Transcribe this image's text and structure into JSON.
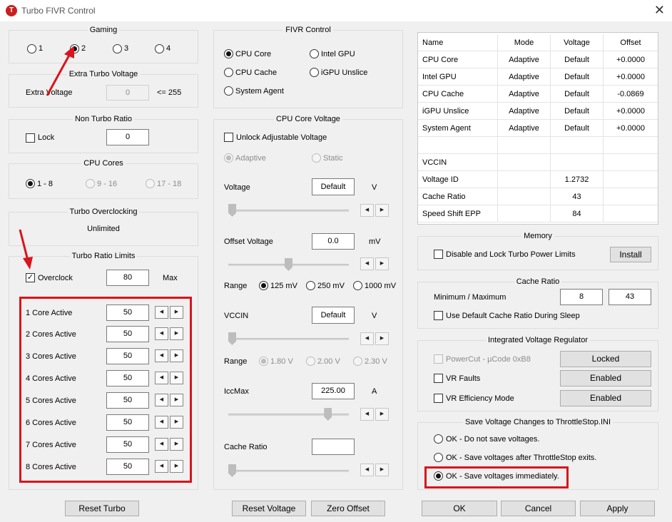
{
  "window": {
    "title": "Turbo FIVR Control",
    "icon_letter": "T",
    "close": "✕"
  },
  "gaming": {
    "title": "Gaming",
    "options": [
      "1",
      "2",
      "3",
      "4"
    ],
    "selected": "2"
  },
  "extra_turbo": {
    "title": "Extra Turbo Voltage",
    "label": "Extra Voltage",
    "value": "0",
    "suffix": "<= 255"
  },
  "non_turbo": {
    "title": "Non Turbo Ratio",
    "lock_label": "Lock",
    "value": "0"
  },
  "cpu_cores": {
    "title": "CPU Cores",
    "options": [
      "1 - 8",
      "9 - 16",
      "17 - 18"
    ]
  },
  "turbo_oc": {
    "title": "Turbo Overclocking",
    "value": "Unlimited"
  },
  "turbo_ratio": {
    "title": "Turbo Ratio Limits",
    "overclock_label": "Overclock",
    "overclock_checked": true,
    "overclock_value": "80",
    "max_label": "Max",
    "rows": [
      {
        "label": "1 Core Active",
        "value": "50"
      },
      {
        "label": "2 Cores Active",
        "value": "50"
      },
      {
        "label": "3 Cores Active",
        "value": "50"
      },
      {
        "label": "4 Cores Active",
        "value": "50"
      },
      {
        "label": "5 Cores Active",
        "value": "50"
      },
      {
        "label": "6 Cores Active",
        "value": "50"
      },
      {
        "label": "7 Cores Active",
        "value": "50"
      },
      {
        "label": "8 Cores Active",
        "value": "50"
      }
    ],
    "reset_button": "Reset Turbo"
  },
  "fivr_control": {
    "title": "FIVR Control",
    "options": [
      "CPU Core",
      "Intel GPU",
      "CPU Cache",
      "iGPU Unslice",
      "System Agent"
    ],
    "selected": "CPU Core"
  },
  "core_voltage": {
    "title": "CPU Core Voltage",
    "unlock_label": "Unlock Adjustable Voltage",
    "adaptive_label": "Adaptive",
    "static_label": "Static",
    "voltage_label": "Voltage",
    "voltage_value": "Default",
    "voltage_unit": "V",
    "offset_label": "Offset Voltage",
    "offset_value": "0.0",
    "offset_unit": "mV",
    "range_label": "Range",
    "range_options": [
      "125 mV",
      "250 mV",
      "1000 mV"
    ],
    "range_selected": "125 mV",
    "vccin_label": "VCCIN",
    "vccin_value": "Default",
    "vccin_unit": "V",
    "range2_label": "Range",
    "range2_options": [
      "1.80 V",
      "2.00 V",
      "2.30 V"
    ],
    "iccmax_label": "IccMax",
    "iccmax_value": "225.00",
    "iccmax_unit": "A",
    "cache_ratio_label": "Cache Ratio",
    "cache_ratio_value": "",
    "slider_levels": {
      "voltage": 0.0,
      "offset": 0.5,
      "vccin": 0.0,
      "iccmax": 0.85,
      "cache_ratio": 0.0
    }
  },
  "buttons": {
    "reset_voltage": "Reset Voltage",
    "zero_offset": "Zero Offset",
    "ok": "OK",
    "cancel": "Cancel",
    "apply": "Apply",
    "install": "Install"
  },
  "info_table": {
    "headers": [
      "Name",
      "Mode",
      "Voltage",
      "Offset"
    ],
    "rows": [
      [
        "CPU Core",
        "Adaptive",
        "Default",
        "+0.0000"
      ],
      [
        "Intel GPU",
        "Adaptive",
        "Default",
        "+0.0000"
      ],
      [
        "CPU Cache",
        "Adaptive",
        "Default",
        "-0.0869"
      ],
      [
        "iGPU Unslice",
        "Adaptive",
        "Default",
        "+0.0000"
      ],
      [
        "System Agent",
        "Adaptive",
        "Default",
        "+0.0000"
      ],
      [
        "",
        "",
        "",
        ""
      ],
      [
        "VCCIN",
        "",
        "",
        ""
      ],
      [
        "Voltage ID",
        "",
        "1.2732",
        ""
      ],
      [
        "Cache Ratio",
        "",
        "43",
        ""
      ],
      [
        "Speed Shift EPP",
        "",
        "84",
        ""
      ]
    ]
  },
  "memory": {
    "title": "Memory",
    "checkbox_label": "Disable and Lock Turbo Power Limits"
  },
  "cache_ratio": {
    "title": "Cache Ratio",
    "min_max_label": "Minimum / Maximum",
    "min": "8",
    "max": "43",
    "sleep_label": "Use Default Cache Ratio During Sleep"
  },
  "ivr": {
    "title": "Integrated Voltage Regulator",
    "powercut_label": "PowerCut  -  µCode 0xB8",
    "powercut_value": "Locked",
    "vr_faults_label": "VR Faults",
    "vr_faults_value": "Enabled",
    "vr_eff_label": "VR Efficiency Mode",
    "vr_eff_value": "Enabled"
  },
  "save": {
    "title": "Save Voltage Changes to ThrottleStop.INI",
    "options": [
      "OK - Do not save voltages.",
      "OK - Save voltages after ThrottleStop exits.",
      "OK - Save voltages immediately."
    ],
    "selected": "OK - Save voltages immediately."
  },
  "colors": {
    "annotation_red": "#d9141c",
    "app_icon": "#c8201e",
    "window_bg": "#f0f0f0"
  }
}
